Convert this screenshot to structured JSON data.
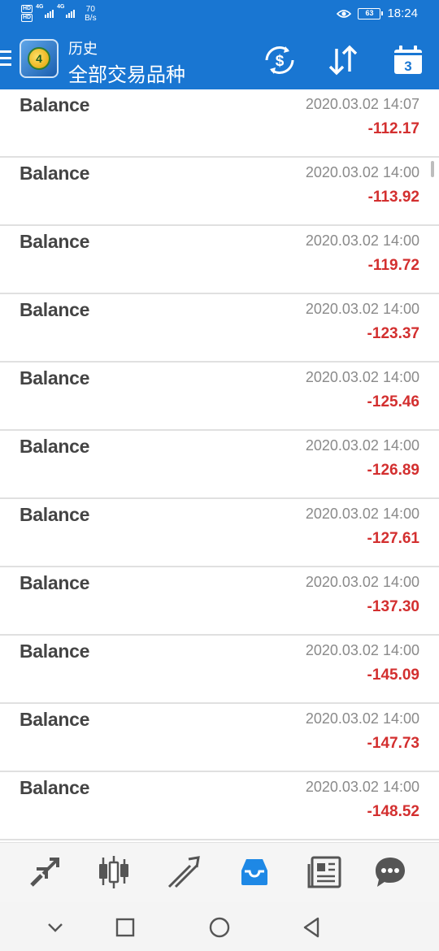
{
  "status_bar": {
    "network_speed_value": "70",
    "network_speed_unit": "B/s",
    "signal_1": "4G",
    "signal_2": "4G",
    "hd_1": "HD",
    "hd_2": "HD",
    "battery": "63",
    "time": "18:24"
  },
  "app_bar": {
    "subtitle": "历史",
    "title": "全部交易品种",
    "calendar_day": "3"
  },
  "history": [
    {
      "type": "Balance",
      "time": "2020.03.02 14:07",
      "profit": "-112.17"
    },
    {
      "type": "Balance",
      "time": "2020.03.02 14:00",
      "profit": "-113.92"
    },
    {
      "type": "Balance",
      "time": "2020.03.02 14:00",
      "profit": "-119.72"
    },
    {
      "type": "Balance",
      "time": "2020.03.02 14:00",
      "profit": "-123.37"
    },
    {
      "type": "Balance",
      "time": "2020.03.02 14:00",
      "profit": "-125.46"
    },
    {
      "type": "Balance",
      "time": "2020.03.02 14:00",
      "profit": "-126.89"
    },
    {
      "type": "Balance",
      "time": "2020.03.02 14:00",
      "profit": "-127.61"
    },
    {
      "type": "Balance",
      "time": "2020.03.02 14:00",
      "profit": "-137.30"
    },
    {
      "type": "Balance",
      "time": "2020.03.02 14:00",
      "profit": "-145.09"
    },
    {
      "type": "Balance",
      "time": "2020.03.02 14:00",
      "profit": "-147.73"
    },
    {
      "type": "Balance",
      "time": "2020.03.02 14:00",
      "profit": "-148.52"
    }
  ],
  "bottom_nav": [
    {
      "icon": "quotes-icon",
      "active": false
    },
    {
      "icon": "chart-icon",
      "active": false
    },
    {
      "icon": "trade-icon",
      "active": false
    },
    {
      "icon": "history-icon",
      "active": true
    },
    {
      "icon": "news-icon",
      "active": false
    },
    {
      "icon": "chat-icon",
      "active": false
    }
  ],
  "colors": {
    "primary": "#1976d2",
    "negative": "#d32f2f",
    "active_nav": "#1e88e5",
    "inactive_nav": "#555555"
  }
}
